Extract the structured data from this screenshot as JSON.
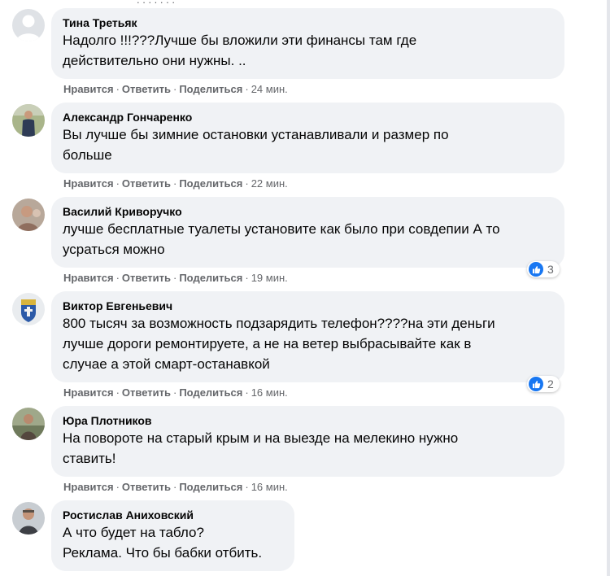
{
  "comments": [
    {
      "author": "Тина Третьяк",
      "lines": [
        "Надолго !!!???Лучше бы вложили эти финансы там где",
        "действительно они нужны. .."
      ],
      "like": "Нравится",
      "reply": "Ответить",
      "share": "Поделиться",
      "time": "24 мин."
    },
    {
      "author": "Александр Гончаренко",
      "lines": [
        "Вы лучше бы зимние остановки устанавливали и размер по",
        "больше"
      ],
      "like": "Нравится",
      "reply": "Ответить",
      "share": "Поделиться",
      "time": "22 мин."
    },
    {
      "author": "Василий Криворучко",
      "lines": [
        "лучше бесплатные туалеты установите как было при совдепии А то",
        "усраться можно"
      ],
      "like": "Нравится",
      "reply": "Ответить",
      "share": "Поделиться",
      "time": "19 мин.",
      "reactions": "3"
    },
    {
      "author": "Виктор Евгеньевич",
      "lines": [
        "800 тысяч за возможность подзарядить телефон????на эти деньги",
        "лучше дороги ремонтируете, а не на ветер выбрасывайте как в",
        "случае а этой смарт-останавкой"
      ],
      "like": "Нравится",
      "reply": "Ответить",
      "share": "Поделиться",
      "time": "16 мин.",
      "reactions": "2"
    },
    {
      "author": "Юра Плотников",
      "lines": [
        "На повороте на старый крым и на выезде на мелекино нужно",
        "ставить!"
      ],
      "like": "Нравится",
      "reply": "Ответить",
      "share": "Поделиться",
      "time": "16 мин."
    },
    {
      "author": "Ростислав Аниховский",
      "lines": [
        "А что будет на табло?",
        "Реклама. Что бы бабки отбить."
      ]
    }
  ],
  "separator": "·",
  "icons": {
    "like_badge": "thumbs-up-icon",
    "default_avatar": "default-avatar-icon"
  },
  "colors": {
    "bubble": "#f0f2f5",
    "meta_text": "#65676b",
    "like_blue": "#1877f2"
  }
}
